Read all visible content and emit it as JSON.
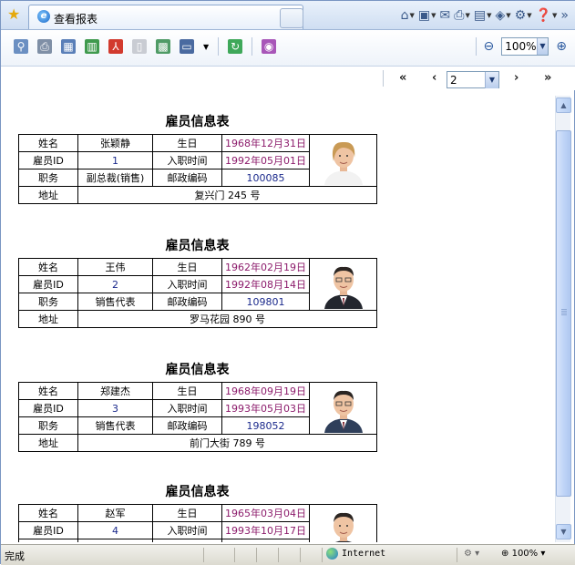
{
  "browser": {
    "tab_title": "查看报表",
    "status_text": "完成",
    "zone_label": "Internet",
    "status_zoom": "100%"
  },
  "toolbar": {
    "zoom_value": "100%"
  },
  "pager": {
    "first": "«",
    "prev": "‹",
    "page_value": "2",
    "next": "›",
    "last": "»"
  },
  "labels": {
    "card_title": "雇员信息表",
    "name": "姓名",
    "birth": "生日",
    "emp_id": "雇员ID",
    "hire": "入职时间",
    "position": "职务",
    "postal": "邮政编码",
    "address": "地址"
  },
  "employees": [
    {
      "name": "张颖静",
      "birth": "1968年12月31日",
      "id": "1",
      "hire": "1992年05月01日",
      "position": "副总裁(销售)",
      "postal": "100085",
      "address": "复兴门 245 号",
      "photo": "female-portrait"
    },
    {
      "name": "王伟",
      "birth": "1962年02月19日",
      "id": "2",
      "hire": "1992年08月14日",
      "position": "销售代表",
      "postal": "109801",
      "address": "罗马花园 890 号",
      "photo": "male-portrait-glasses"
    },
    {
      "name": "郑建杰",
      "birth": "1968年09月19日",
      "id": "3",
      "hire": "1993年05月03日",
      "position": "销售代表",
      "postal": "198052",
      "address": "前门大街 789 号",
      "photo": "male-portrait-young"
    },
    {
      "name": "赵军",
      "birth": "1965年03月04日",
      "id": "4",
      "hire": "1993年10月17日",
      "position": "",
      "postal": "",
      "address": "",
      "photo": "male-portrait-smiling"
    }
  ],
  "colors": {
    "date_text": "#8c1b6b",
    "number_text": "#1b2a8c",
    "chrome_blue": "#cfdef2"
  }
}
